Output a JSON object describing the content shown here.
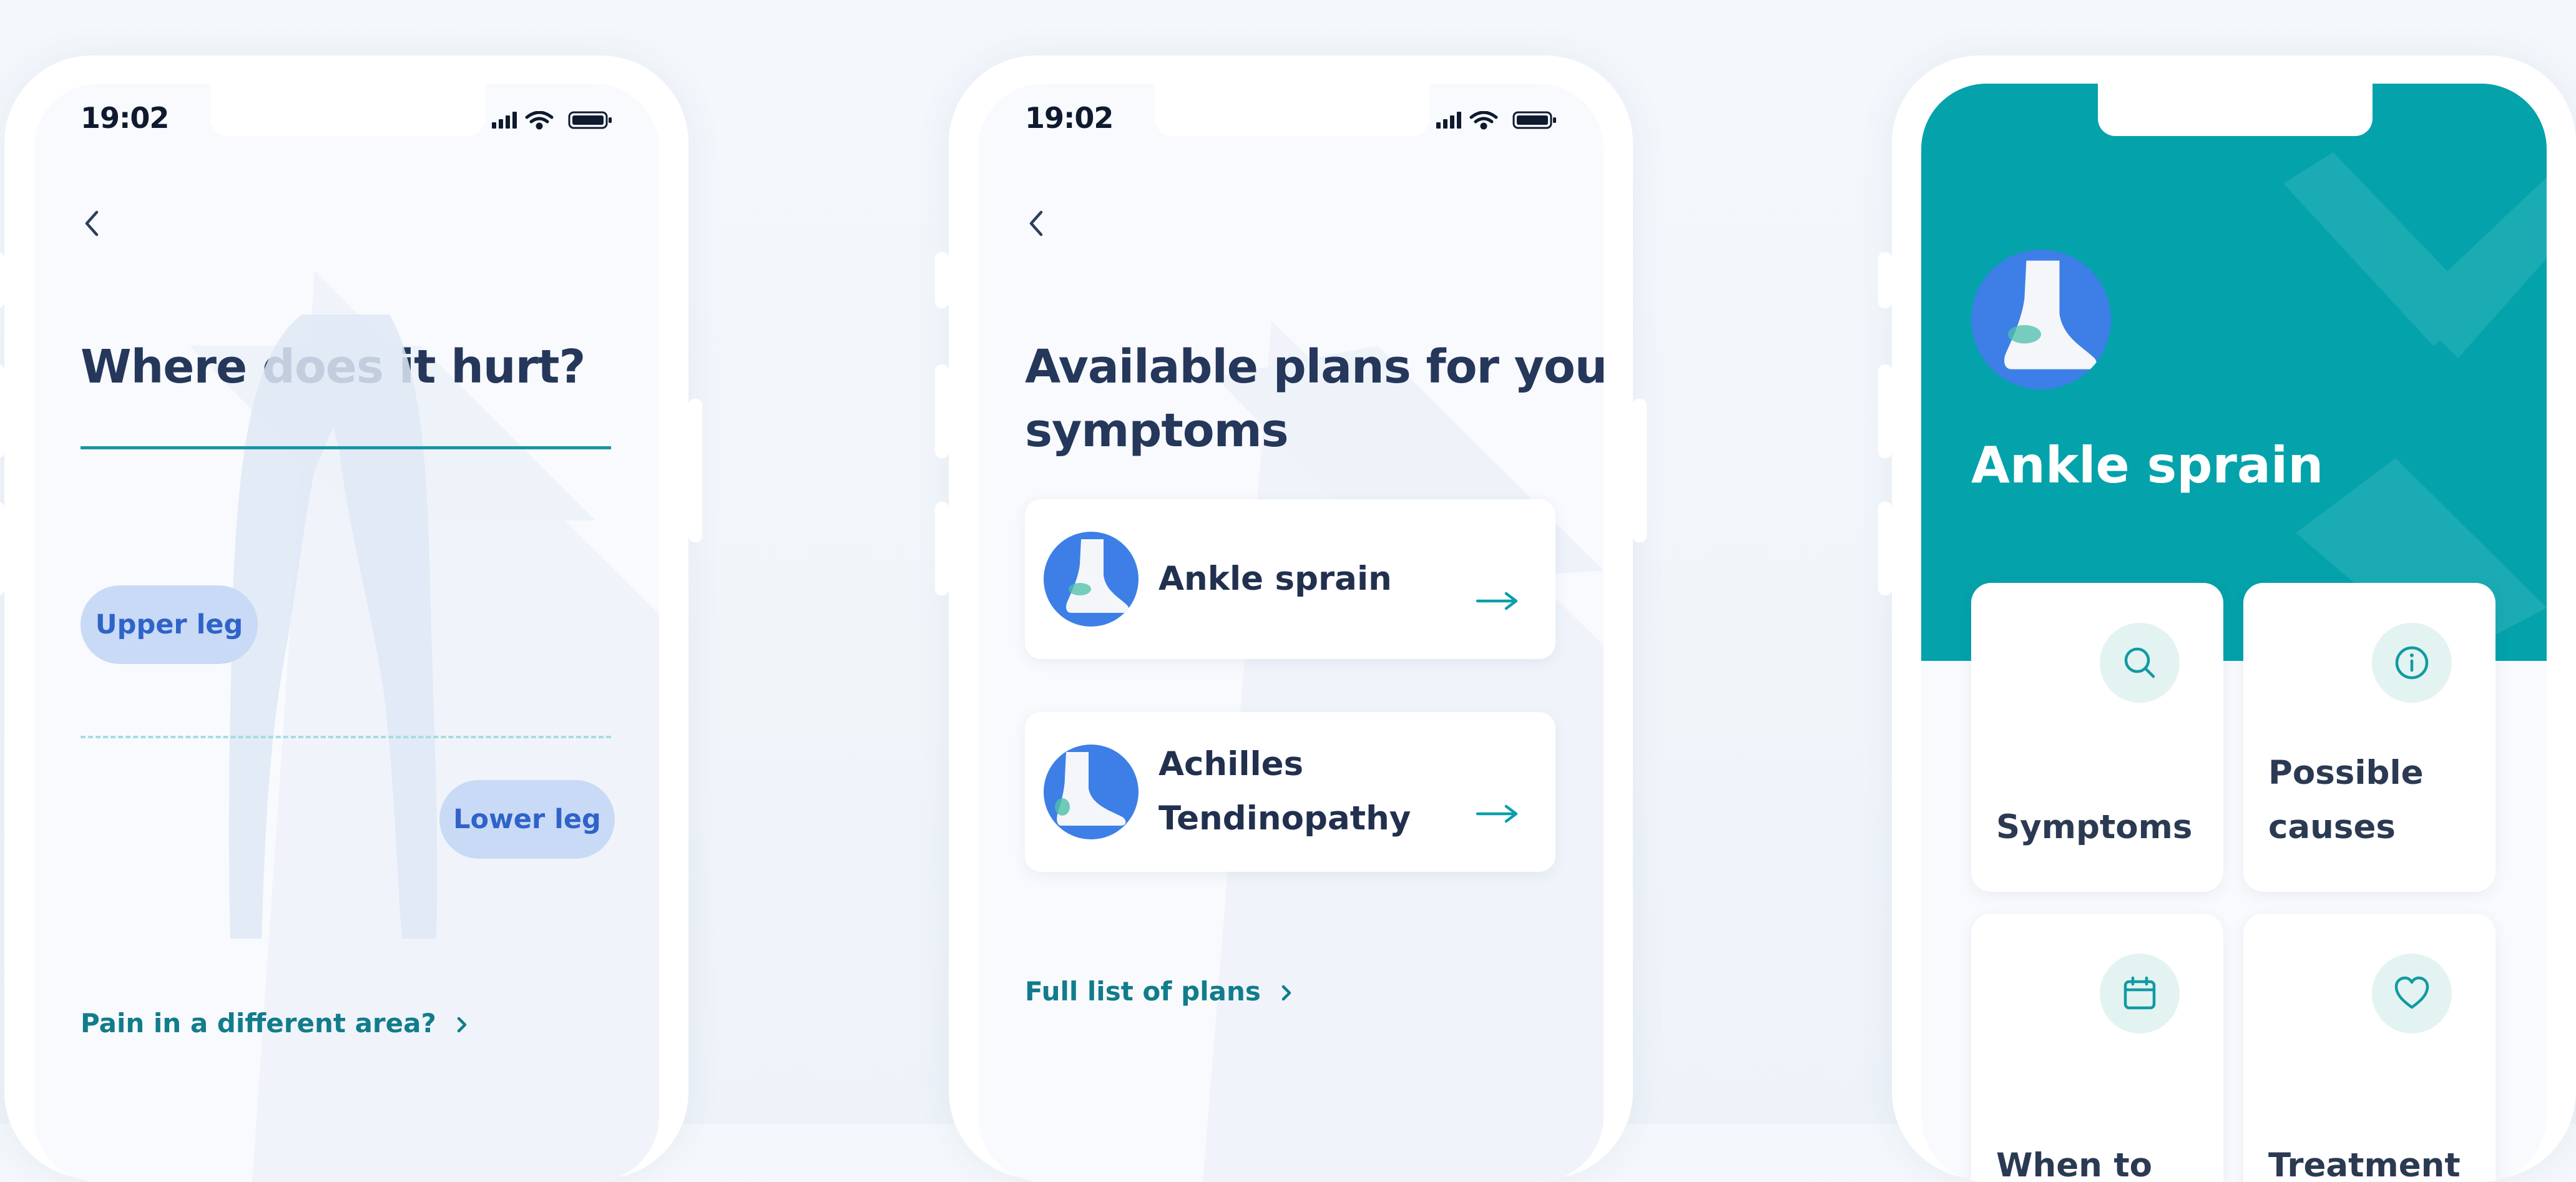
{
  "status_bar": {
    "time": "19:02"
  },
  "screen_where": {
    "title": "Where does it hurt?",
    "chips": [
      "Upper leg",
      "Lower leg"
    ],
    "link": "Pain in a different area?"
  },
  "screen_plans": {
    "title_line1": "Available plans for your",
    "title_line2": "symptoms",
    "plans": [
      {
        "title_line1": "Ankle sprain",
        "title_line2": ""
      },
      {
        "title_line1": "Achilles",
        "title_line2": "Tendinopathy"
      }
    ],
    "link": "Full list of plans"
  },
  "screen_detail": {
    "title": "Ankle sprain",
    "tiles": [
      {
        "label_line1": "Symptoms",
        "label_line2": "",
        "icon": "search-icon"
      },
      {
        "label_line1": "Possible",
        "label_line2": "causes",
        "icon": "info-icon"
      },
      {
        "label_line1": "When to",
        "label_line2": "",
        "icon": "calendar-icon"
      },
      {
        "label_line1": "Treatment",
        "label_line2": "",
        "icon": "heart-icon"
      }
    ]
  },
  "colors": {
    "accent_teal": "#04a2ab",
    "link_teal": "#117c8b",
    "avatar_blue": "#3d7fe6",
    "chip_bg": "#c9daf6",
    "heading": "#25375a"
  }
}
